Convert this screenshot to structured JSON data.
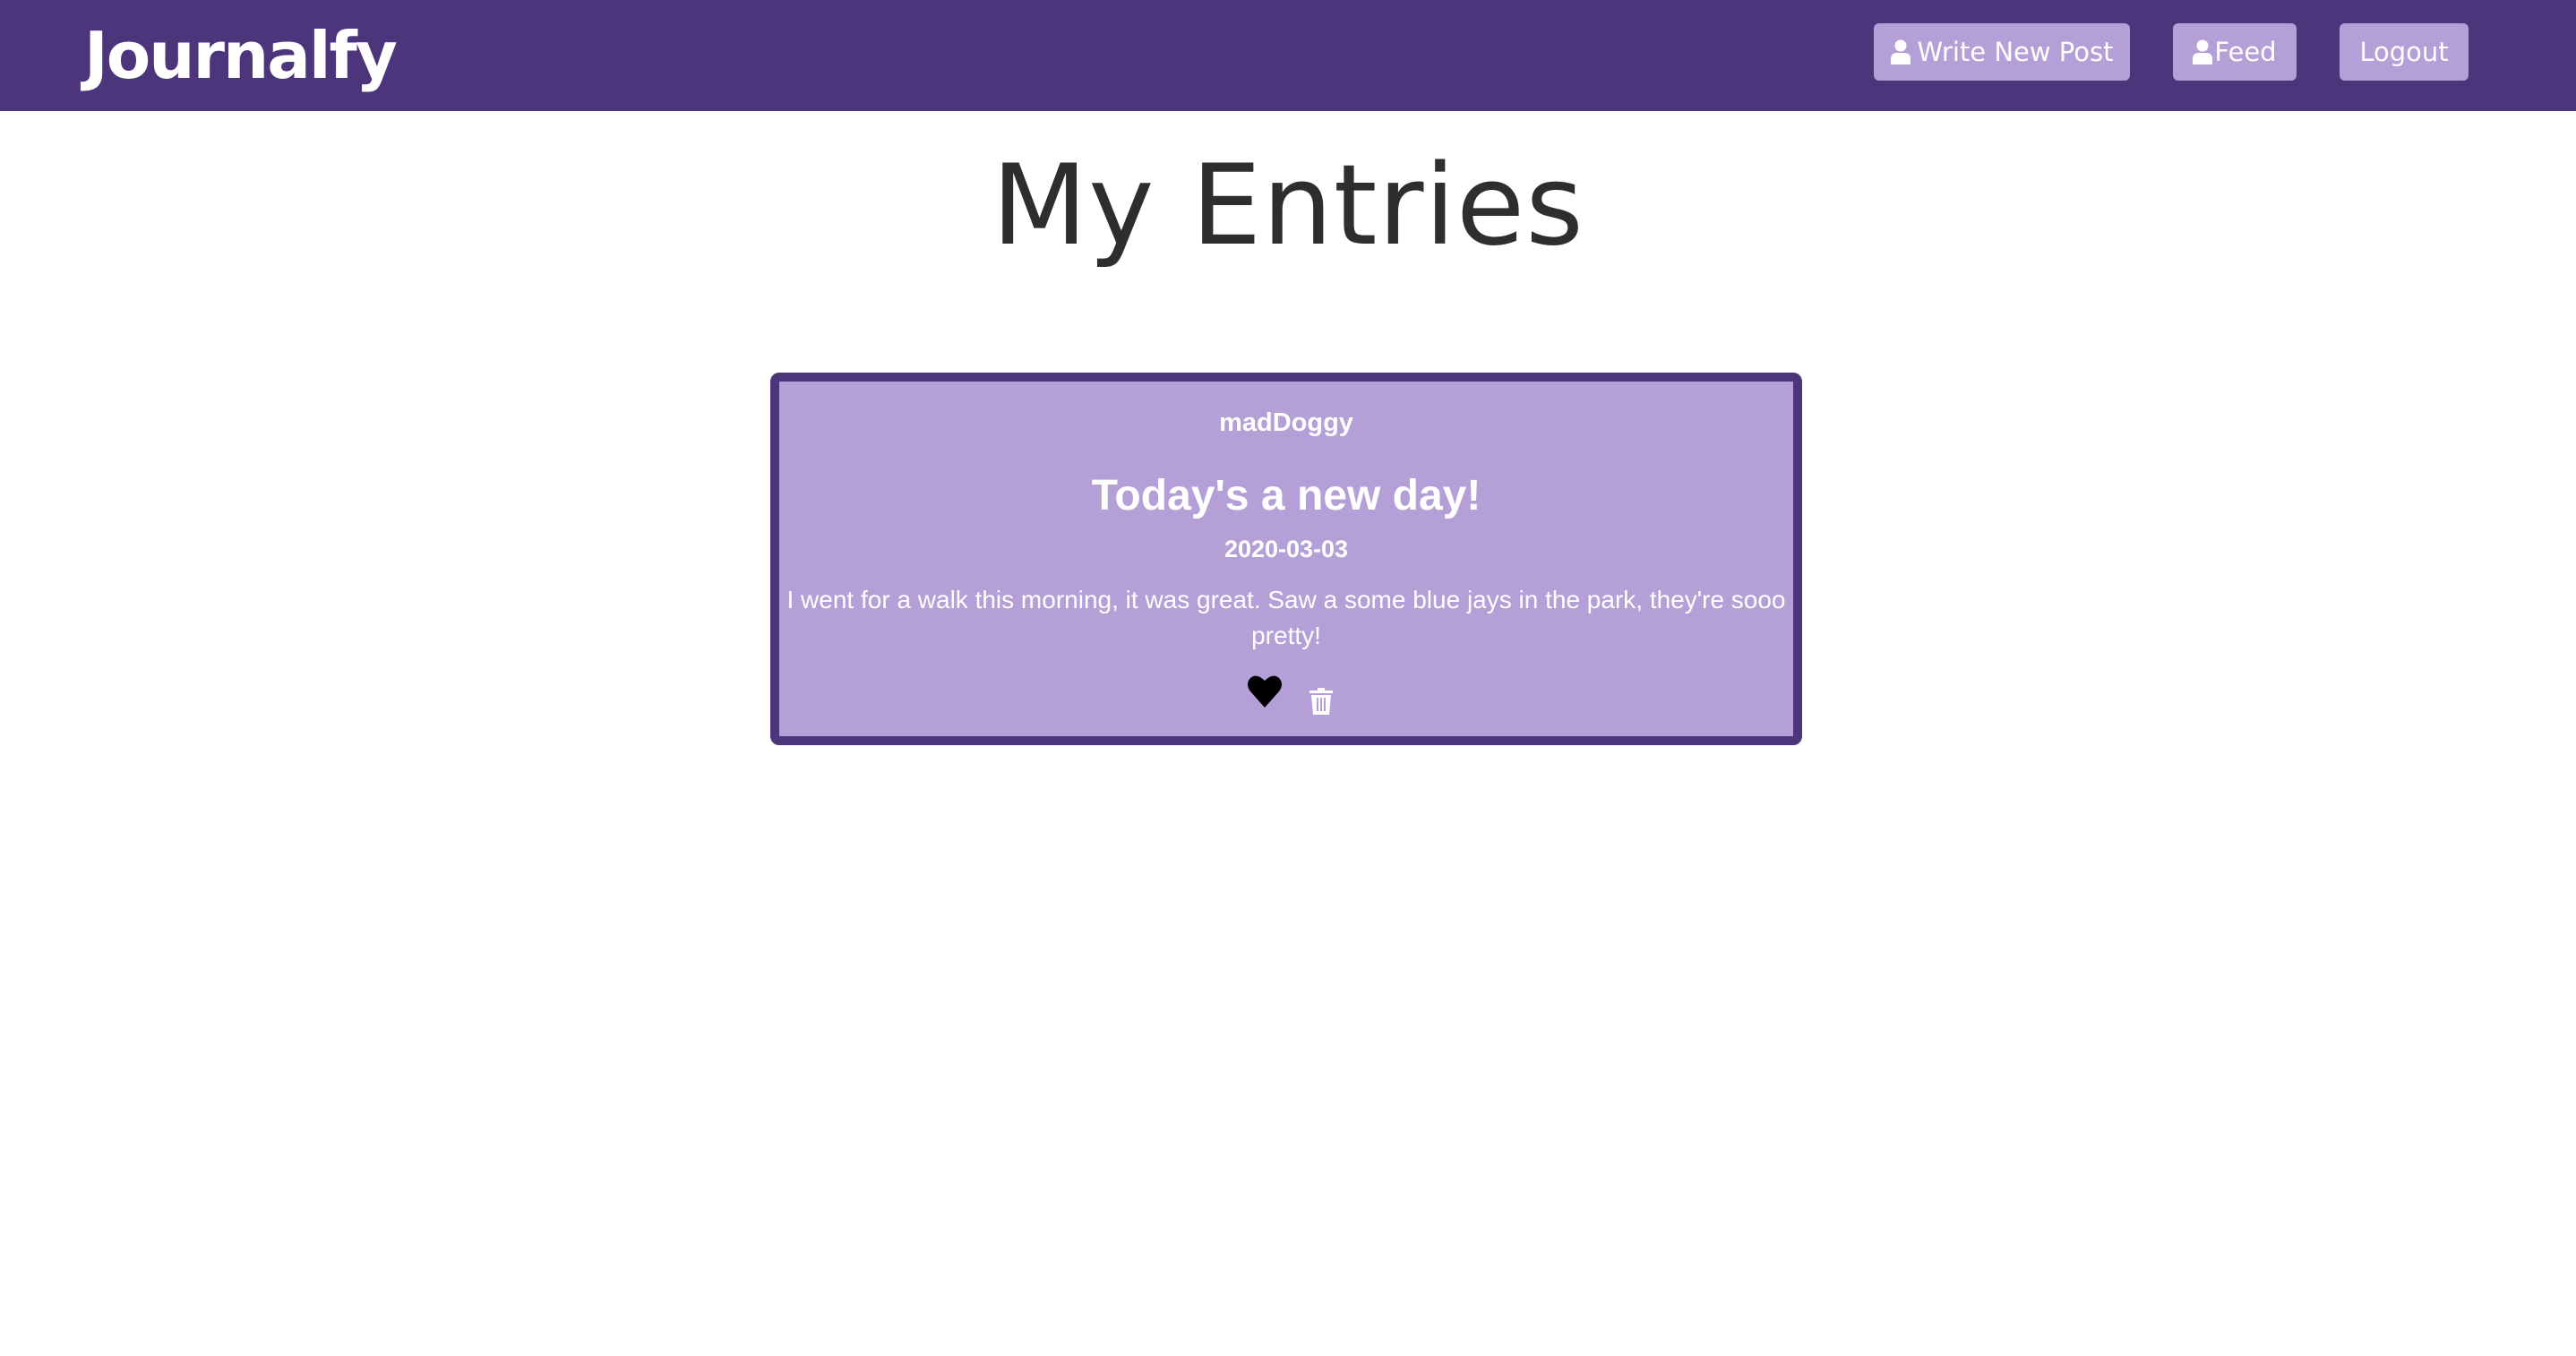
{
  "header": {
    "logo": "Journalfy",
    "nav": {
      "write_label": "Write New Post",
      "feed_label": "Feed",
      "logout_label": "Logout"
    },
    "colors": {
      "bar": "#4c357a",
      "button": "#b4a0d6"
    }
  },
  "main": {
    "title": "My Entries",
    "entries": [
      {
        "author": "madDoggy",
        "title": "Today's a new day!",
        "date": "2020-03-03",
        "body": "I went for a walk this morning, it was great. Saw a some blue jays in the park, they're sooo pretty!",
        "icons": [
          "heart-icon",
          "trash-icon"
        ]
      }
    ]
  }
}
